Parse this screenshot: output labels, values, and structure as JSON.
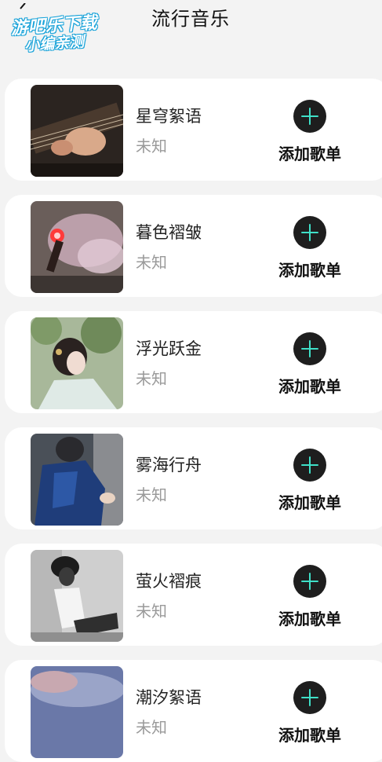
{
  "watermark": {
    "line1": "游吧乐下载",
    "line2": "小编亲测"
  },
  "header": {
    "title": "流行音乐"
  },
  "songs": [
    {
      "title": "星穹絮语",
      "artist": "未知",
      "add_label": "添加歌单",
      "cover": "guitar"
    },
    {
      "title": "暮色褶皱",
      "artist": "未知",
      "add_label": "添加歌单",
      "cover": "flare"
    },
    {
      "title": "浮光跃金",
      "artist": "未知",
      "add_label": "添加歌单",
      "cover": "hanfu"
    },
    {
      "title": "雾海行舟",
      "artist": "未知",
      "add_label": "添加歌单",
      "cover": "blue-jacket"
    },
    {
      "title": "萤火褶痕",
      "artist": "未知",
      "add_label": "添加歌单",
      "cover": "bw-portrait"
    },
    {
      "title": "潮汐絮语",
      "artist": "未知",
      "add_label": "添加歌单",
      "cover": "sky"
    }
  ],
  "colors": {
    "background": "#f3f3f3",
    "card": "#ffffff",
    "add_button": "#1e1e1e",
    "plus": "#3fe0c8",
    "muted_text": "#9a9a9a"
  }
}
